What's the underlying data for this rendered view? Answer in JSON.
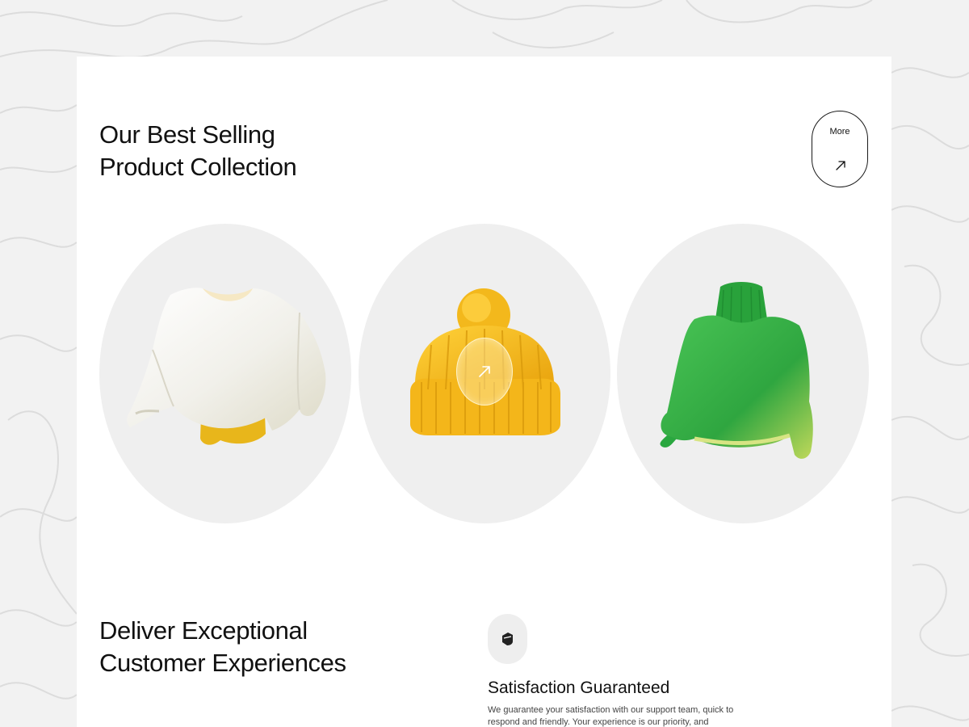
{
  "section_one": {
    "title_line1": "Our Best Selling",
    "title_line2": "Product Collection",
    "more_label": "More"
  },
  "products": [
    {
      "icon": "white-sweater-image",
      "color": "#f3f1ea"
    },
    {
      "icon": "yellow-beanie-image",
      "color": "#f5bd1e",
      "action_icon": "arrow-up-right-icon"
    },
    {
      "icon": "green-turtleneck-image",
      "color": "#3bb44a"
    }
  ],
  "section_two": {
    "title_line1": "Deliver Exceptional",
    "title_line2": "Customer Experiences",
    "feature_icon": "shield-icon",
    "feature_title": "Satisfaction Guaranteed",
    "feature_text": "We guarantee your satisfaction with our support team, quick to respond and friendly. Your experience is our priority, and"
  },
  "colors": {
    "page_background": "#f2f2f2",
    "card_background": "#ffffff",
    "product_background": "#efefef",
    "text": "#111111"
  }
}
